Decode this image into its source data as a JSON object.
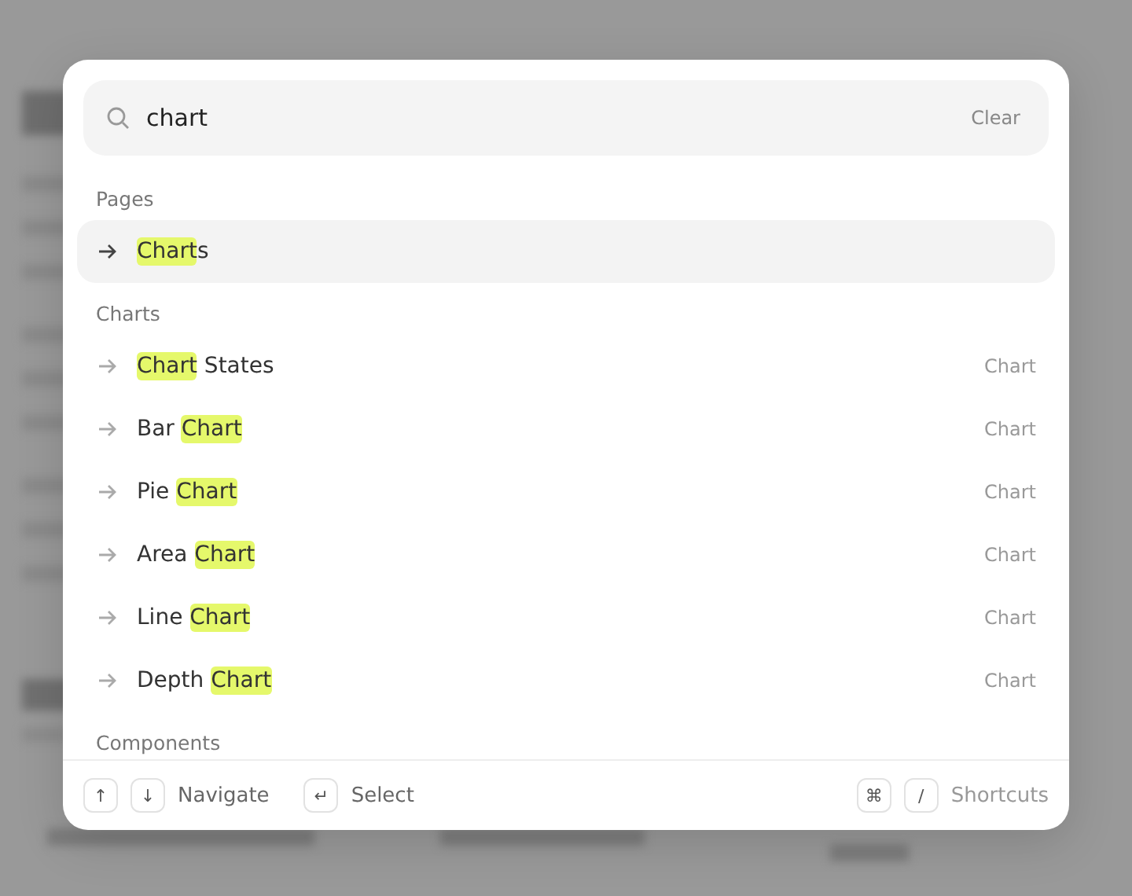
{
  "search": {
    "value": "chart",
    "clear": "Clear"
  },
  "groups": [
    {
      "heading": "Pages",
      "items": [
        {
          "parts": [
            {
              "text": "Chart",
              "match": true
            },
            {
              "text": "s",
              "match": false
            }
          ],
          "selected": true
        }
      ]
    },
    {
      "heading": "Charts",
      "items": [
        {
          "parts": [
            {
              "text": "Chart",
              "match": true
            },
            {
              "text": " States",
              "match": false
            }
          ],
          "tag": "Chart",
          "selected": false
        },
        {
          "parts": [
            {
              "text": "Bar ",
              "match": false
            },
            {
              "text": "Chart",
              "match": true
            }
          ],
          "tag": "Chart",
          "selected": false
        },
        {
          "parts": [
            {
              "text": "Pie ",
              "match": false
            },
            {
              "text": "Chart",
              "match": true
            }
          ],
          "tag": "Chart",
          "selected": false
        },
        {
          "parts": [
            {
              "text": "Area ",
              "match": false
            },
            {
              "text": "Chart",
              "match": true
            }
          ],
          "tag": "Chart",
          "selected": false
        },
        {
          "parts": [
            {
              "text": "Line ",
              "match": false
            },
            {
              "text": "Chart",
              "match": true
            }
          ],
          "tag": "Chart",
          "selected": false
        },
        {
          "parts": [
            {
              "text": "Depth ",
              "match": false
            },
            {
              "text": "Chart",
              "match": true
            }
          ],
          "tag": "Chart",
          "selected": false
        }
      ]
    },
    {
      "heading": "Components"
    }
  ],
  "footer": {
    "left": [
      {
        "keys": [
          "↑",
          "↓"
        ],
        "label": "Navigate"
      },
      {
        "keys": [
          "↵"
        ],
        "label": "Select"
      }
    ],
    "right": [
      {
        "keys": [
          "⌘",
          "/"
        ],
        "label": "Shortcuts"
      }
    ]
  }
}
